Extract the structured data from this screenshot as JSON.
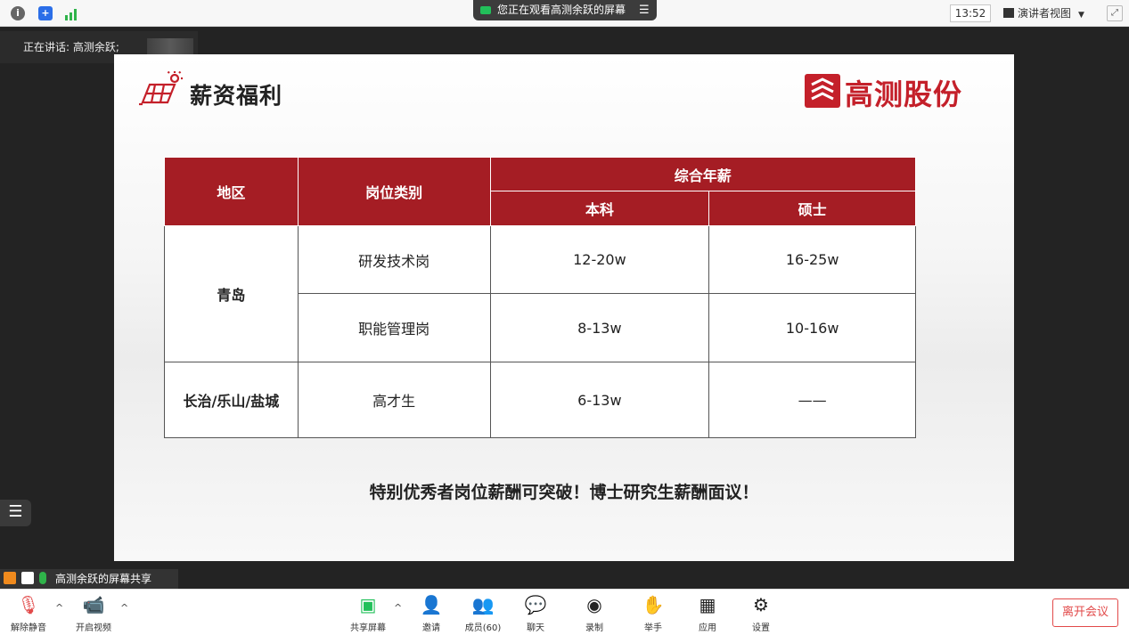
{
  "topbar": {
    "info_icon": "info-icon",
    "shield_icon": "shield-icon",
    "signal_icon": "signal-icon",
    "viewing_text": "您正在观看高测余跃的屏幕",
    "viewing_menu_icon": "menu-icon",
    "clock": "13:52",
    "speaker_view_label": "演讲者视图",
    "fullscreen_icon": "fullscreen-icon"
  },
  "stage": {
    "speaking_label": "正在讲话: 高测余跃;",
    "share_label": "高测余跃的屏幕共享"
  },
  "slide": {
    "title": "薪资福利",
    "logo_text": "高测股份",
    "table": {
      "headers": {
        "region": "地区",
        "position": "岗位类别",
        "salary": "综合年薪",
        "bachelor": "本科",
        "master": "硕士"
      },
      "rows": [
        {
          "region": "青岛",
          "position": "研发技术岗",
          "bachelor": "12-20w",
          "master": "16-25w"
        },
        {
          "region": "",
          "position": "职能管理岗",
          "bachelor": "8-13w",
          "master": "10-16w"
        },
        {
          "region": "长治/乐山/盐城",
          "position": "高才生",
          "bachelor": "6-13w",
          "master": "——"
        }
      ]
    },
    "footnote": "特别优秀者岗位薪酬可突破！博士研究生薪酬面议！"
  },
  "toolbar": {
    "mute": "解除静音",
    "video": "开启视频",
    "share": "共享屏幕",
    "invite": "邀请",
    "members": "成员(60)",
    "chat": "聊天",
    "record": "录制",
    "raise_hand": "举手",
    "apps": "应用",
    "settings": "设置",
    "leave": "离开会议"
  },
  "colors": {
    "accent_red": "#a51d24",
    "brand_red": "#c4202a",
    "leave_red": "#e24a4a",
    "share_green": "#22c05a"
  }
}
